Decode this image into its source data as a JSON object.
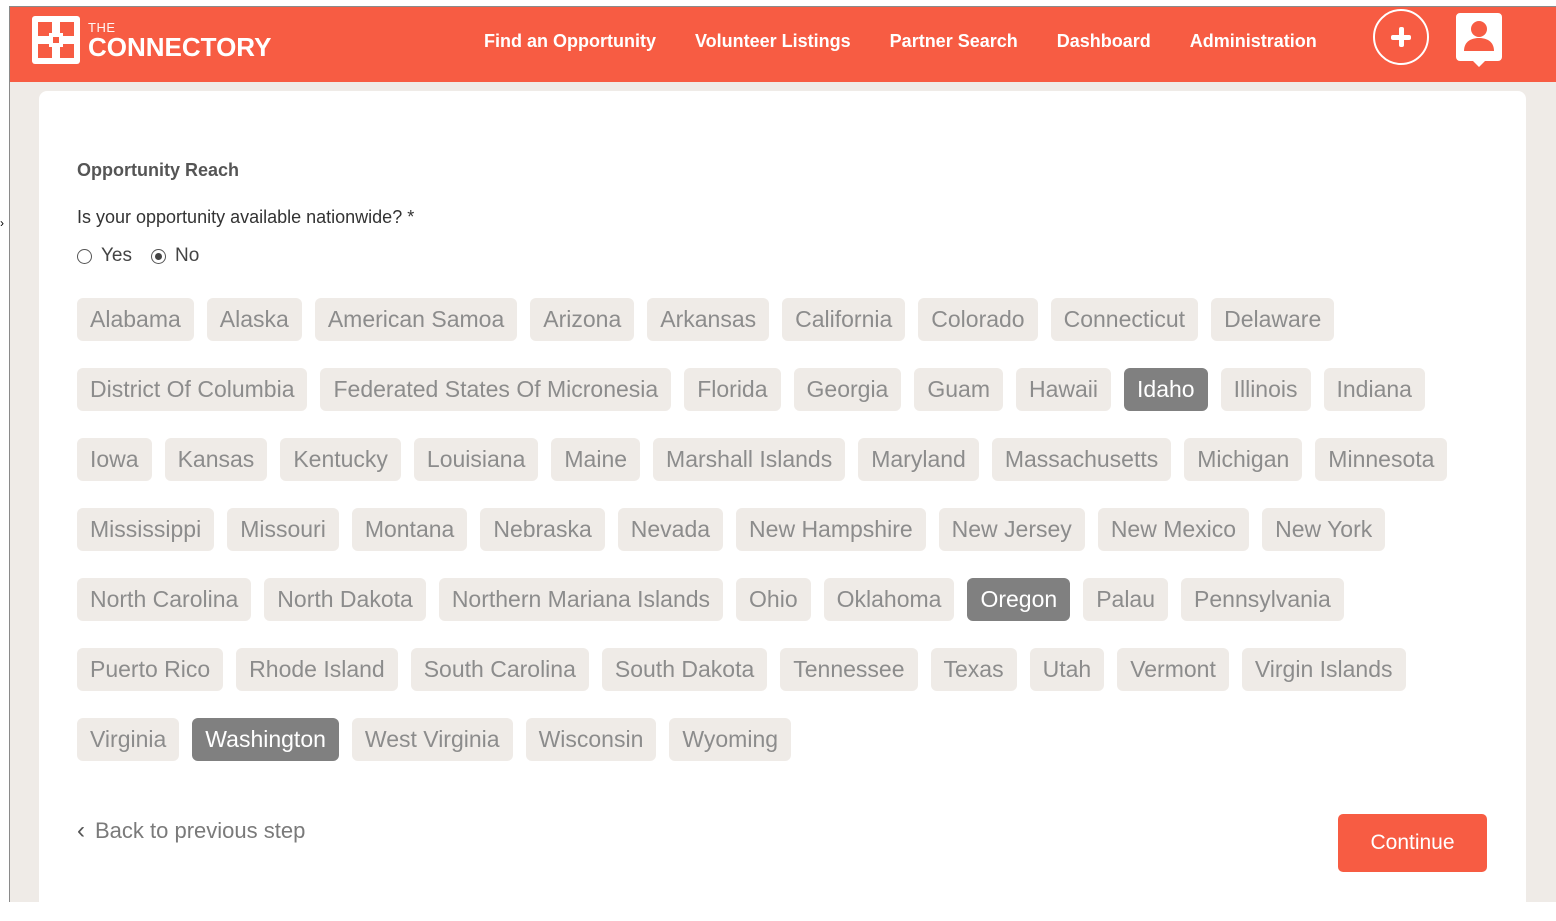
{
  "brand": {
    "small": "THE",
    "name": "CONNECTORY"
  },
  "nav": {
    "items": [
      {
        "label": "Find an Opportunity"
      },
      {
        "label": "Volunteer Listings"
      },
      {
        "label": "Partner Search"
      },
      {
        "label": "Dashboard"
      },
      {
        "label": "Administration"
      }
    ],
    "add_icon": "plus-circle-icon",
    "user_icon": "user-profile-icon"
  },
  "form": {
    "section_title": "Opportunity Reach",
    "question": "Is your opportunity available nationwide? *",
    "radio_options": [
      {
        "label": "Yes",
        "checked": false
      },
      {
        "label": "No",
        "checked": true
      }
    ],
    "states": [
      {
        "label": "Alabama",
        "selected": false
      },
      {
        "label": "Alaska",
        "selected": false
      },
      {
        "label": "American Samoa",
        "selected": false
      },
      {
        "label": "Arizona",
        "selected": false
      },
      {
        "label": "Arkansas",
        "selected": false
      },
      {
        "label": "California",
        "selected": false
      },
      {
        "label": "Colorado",
        "selected": false
      },
      {
        "label": "Connecticut",
        "selected": false
      },
      {
        "label": "Delaware",
        "selected": false
      },
      {
        "label": "District Of Columbia",
        "selected": false
      },
      {
        "label": "Federated States Of Micronesia",
        "selected": false
      },
      {
        "label": "Florida",
        "selected": false
      },
      {
        "label": "Georgia",
        "selected": false
      },
      {
        "label": "Guam",
        "selected": false
      },
      {
        "label": "Hawaii",
        "selected": false
      },
      {
        "label": "Idaho",
        "selected": true
      },
      {
        "label": "Illinois",
        "selected": false
      },
      {
        "label": "Indiana",
        "selected": false
      },
      {
        "label": "Iowa",
        "selected": false
      },
      {
        "label": "Kansas",
        "selected": false
      },
      {
        "label": "Kentucky",
        "selected": false
      },
      {
        "label": "Louisiana",
        "selected": false
      },
      {
        "label": "Maine",
        "selected": false
      },
      {
        "label": "Marshall Islands",
        "selected": false
      },
      {
        "label": "Maryland",
        "selected": false
      },
      {
        "label": "Massachusetts",
        "selected": false
      },
      {
        "label": "Michigan",
        "selected": false
      },
      {
        "label": "Minnesota",
        "selected": false
      },
      {
        "label": "Mississippi",
        "selected": false
      },
      {
        "label": "Missouri",
        "selected": false
      },
      {
        "label": "Montana",
        "selected": false
      },
      {
        "label": "Nebraska",
        "selected": false
      },
      {
        "label": "Nevada",
        "selected": false
      },
      {
        "label": "New Hampshire",
        "selected": false
      },
      {
        "label": "New Jersey",
        "selected": false
      },
      {
        "label": "New Mexico",
        "selected": false
      },
      {
        "label": "New York",
        "selected": false
      },
      {
        "label": "North Carolina",
        "selected": false
      },
      {
        "label": "North Dakota",
        "selected": false
      },
      {
        "label": "Northern Mariana Islands",
        "selected": false
      },
      {
        "label": "Ohio",
        "selected": false
      },
      {
        "label": "Oklahoma",
        "selected": false
      },
      {
        "label": "Oregon",
        "selected": true
      },
      {
        "label": "Palau",
        "selected": false
      },
      {
        "label": "Pennsylvania",
        "selected": false
      },
      {
        "label": "Puerto Rico",
        "selected": false
      },
      {
        "label": "Rhode Island",
        "selected": false
      },
      {
        "label": "South Carolina",
        "selected": false
      },
      {
        "label": "South Dakota",
        "selected": false
      },
      {
        "label": "Tennessee",
        "selected": false
      },
      {
        "label": "Texas",
        "selected": false
      },
      {
        "label": "Utah",
        "selected": false
      },
      {
        "label": "Vermont",
        "selected": false
      },
      {
        "label": "Virgin Islands",
        "selected": false
      },
      {
        "label": "Virginia",
        "selected": false
      },
      {
        "label": "Washington",
        "selected": true
      },
      {
        "label": "West Virginia",
        "selected": false
      },
      {
        "label": "Wisconsin",
        "selected": false
      },
      {
        "label": "Wyoming",
        "selected": false
      }
    ],
    "back_label": "Back to previous step",
    "continue_label": "Continue"
  },
  "colors": {
    "brand": "#f75c43",
    "chip_bg": "#efebe7",
    "chip_selected_bg": "#808080",
    "page_bg": "#efebe7"
  }
}
